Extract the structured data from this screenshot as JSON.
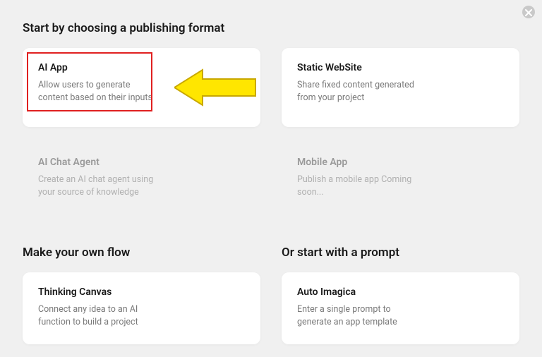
{
  "close_label": "Close",
  "section1": {
    "title": "Start by choosing a publishing format",
    "cards": [
      {
        "title": "AI App",
        "desc": "Allow users to generate content based on their inputs",
        "highlighted": true
      },
      {
        "title": "Static WebSite",
        "desc": "Share fixed content generated from your project"
      },
      {
        "title": "AI Chat Agent",
        "desc": "Create an AI chat agent using your source of knowledge",
        "disabled": true
      },
      {
        "title": "Mobile App",
        "desc": "Publish a mobile app Coming soon...",
        "disabled": true
      }
    ]
  },
  "section2": {
    "left": {
      "title": "Make your own flow",
      "card": {
        "title": "Thinking Canvas",
        "desc": "Connect any idea to an AI function to build a project"
      }
    },
    "right": {
      "title": "Or start with a prompt",
      "card": {
        "title": "Auto Imagica",
        "desc": "Enter a single prompt to generate an app template"
      }
    }
  }
}
